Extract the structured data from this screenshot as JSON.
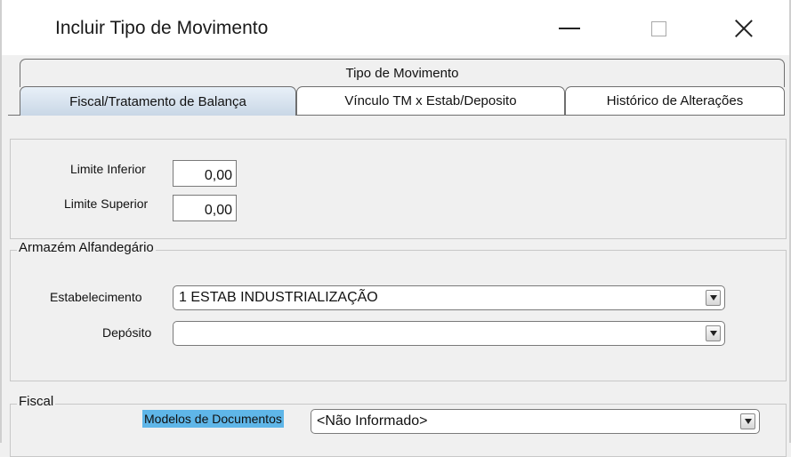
{
  "window": {
    "title": "Incluir Tipo de Movimento"
  },
  "tabs": {
    "row1": "Tipo de Movimento",
    "row2": [
      "Fiscal/Tratamento de Balança",
      "Vínculo TM x Estab/Deposito",
      "Histórico de Alterações"
    ],
    "active": "Fiscal/Tratamento de Balança"
  },
  "limits": {
    "inferior_label": "Limite Inferior",
    "inferior_value": "0,00",
    "superior_label": "Limite Superior",
    "superior_value": "0,00"
  },
  "armazem": {
    "legend": "Armazém Alfandegário",
    "estabelecimento_label": "Estabelecimento",
    "estabelecimento_value": "1 ESTAB INDUSTRIALIZAÇÃO",
    "deposito_label": "Depósito",
    "deposito_value": ""
  },
  "fiscal": {
    "legend": "Fiscal",
    "modelos_label": "Modelos de Documentos",
    "modelos_value": "<Não Informado>"
  },
  "colors": {
    "highlight": "#5fb6e8",
    "active_tab_top": "#e8f0f8",
    "active_tab_bottom": "#c9d7e6"
  }
}
